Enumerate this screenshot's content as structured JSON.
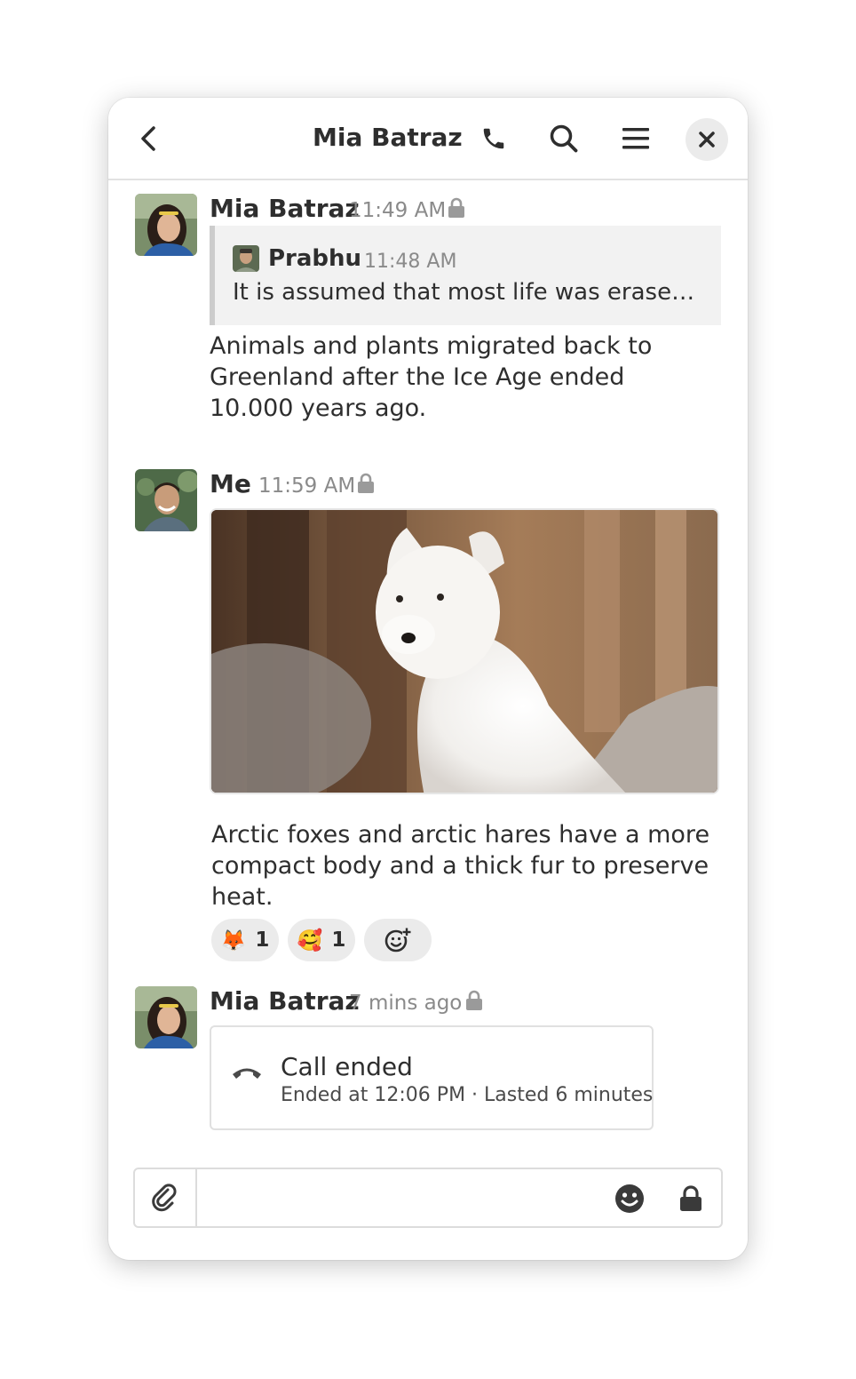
{
  "header": {
    "title": "Mia Batraz",
    "icons": {
      "back": "back-arrow-icon",
      "call": "phone-icon",
      "search": "search-icon",
      "menu": "menu-icon",
      "close": "close-icon"
    }
  },
  "messages": [
    {
      "sender": "Mia Batraz",
      "time": "11:49 AM",
      "quote": {
        "sender": "Prabhu",
        "time": "11:48 AM",
        "text": "It is assumed that most life was erase…"
      },
      "text": "Animals and plants migrated back to Greenland after the Ice Age ended 10.000 years ago."
    },
    {
      "sender": "Me",
      "time": "11:59 AM",
      "text": "Arctic foxes and arctic hares have a more compact body and a thick fur to preserve heat.",
      "reactions": [
        {
          "emoji": "🦊",
          "count": "1"
        },
        {
          "emoji": "🥰",
          "count": "1"
        }
      ]
    },
    {
      "sender": "Mia Batraz",
      "time": "7 mins ago",
      "call": {
        "title": "Call ended",
        "detail": "Ended at 12:06 PM · Lasted 6 minutes"
      }
    }
  ],
  "composer": {
    "placeholder": ""
  },
  "colors": {
    "accent": "#2e2e2e",
    "muted": "#8a8a8a",
    "surface": "#f2f2f2"
  }
}
